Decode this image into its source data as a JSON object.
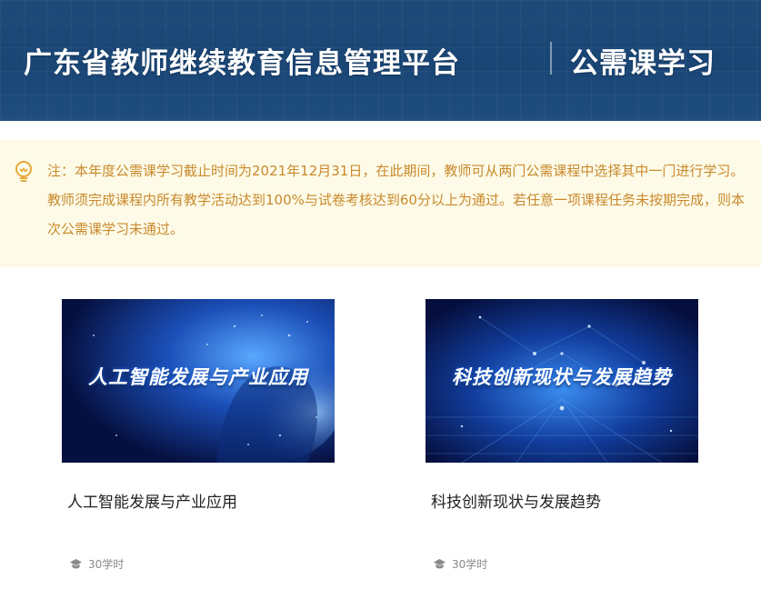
{
  "header": {
    "title": "广东省教师继续教育信息管理平台",
    "subtitle": "公需课学习"
  },
  "notice": {
    "icon": "bulb-icon",
    "text": "注：本年度公需课学习截止时间为2021年12月31日，在此期间，教师可从两门公需课程中选择其中一门进行学习。教师须完成课程内所有教学活动达到100%与试卷考核达到60分以上为通过。若任意一项课程任务未按期完成，则本次公需课学习未通过。"
  },
  "courses": [
    {
      "image_title": "人工智能发展与产业应用",
      "title": "人工智能发展与产业应用",
      "hours": "30学时"
    },
    {
      "image_title": "科技创新现状与发展趋势",
      "title": "科技创新现状与发展趋势",
      "hours": "30学时"
    }
  ],
  "colors": {
    "header_bg": "#1d4a79",
    "notice_bg": "#fdfbe8",
    "notice_text": "#c9892c",
    "card_title": "#222222",
    "meta": "#888888"
  }
}
